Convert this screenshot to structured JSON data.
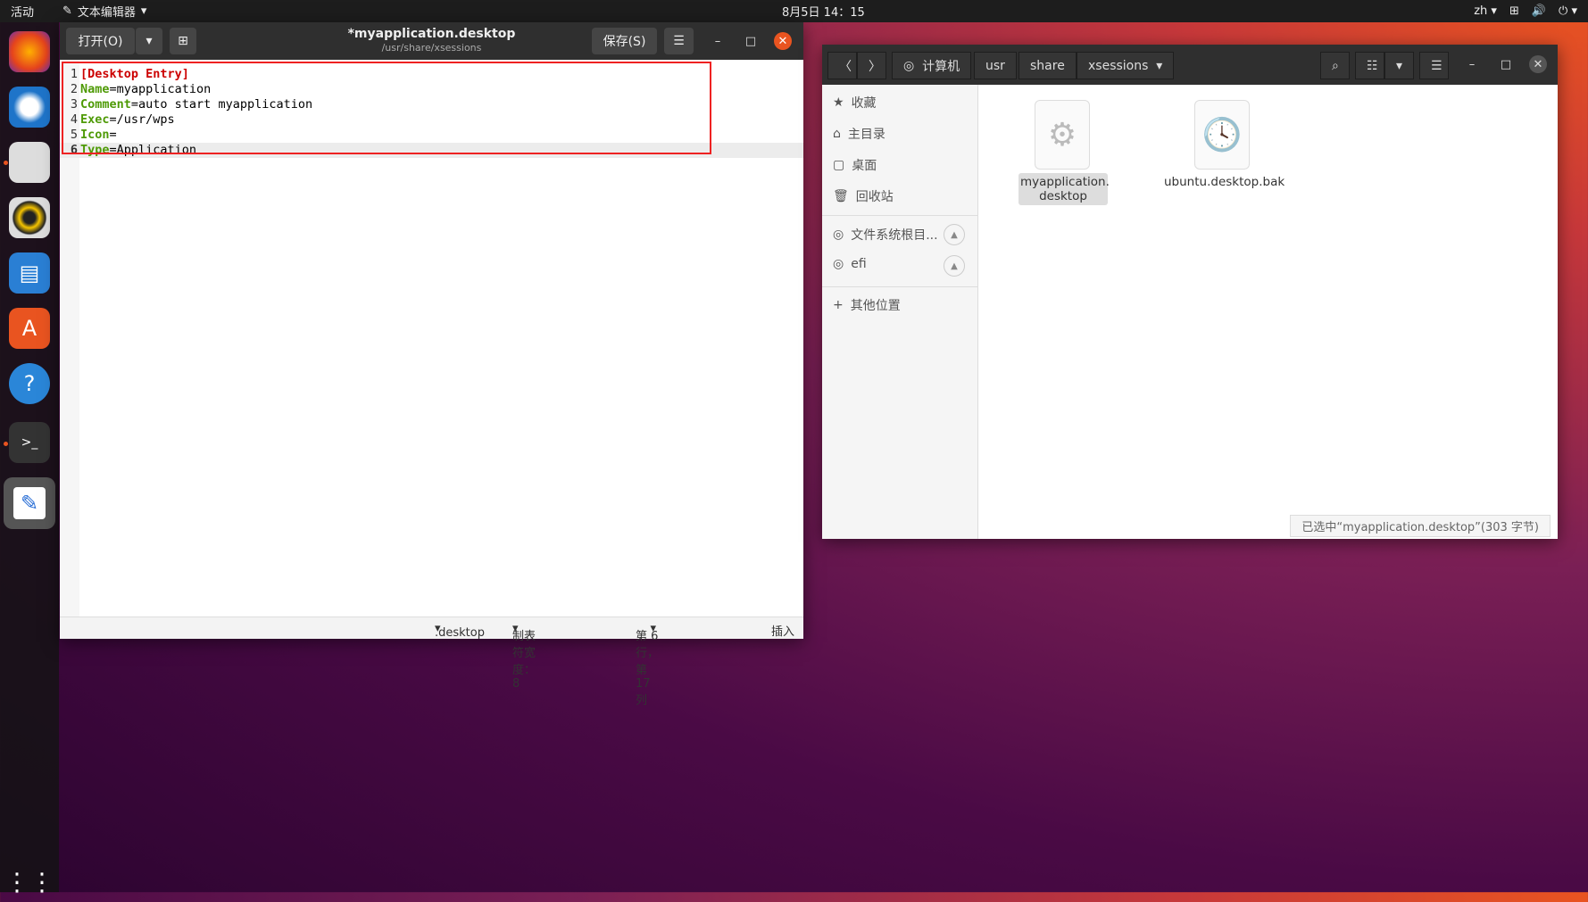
{
  "topbar": {
    "activities": "活动",
    "app_name": "文本编辑器",
    "clock": "8月5日 14：15",
    "lang": "zh"
  },
  "editor": {
    "open_label": "打开(O)",
    "save_label": "保存(S)",
    "title": "*myapplication.desktop",
    "path": "/usr/share/xsessions",
    "lines": [
      {
        "num": "1",
        "key": "",
        "rest": "[Desktop Entry]"
      },
      {
        "num": "2",
        "key": "Name",
        "rest": "=myapplication"
      },
      {
        "num": "3",
        "key": "Comment",
        "rest": "=auto start myapplication"
      },
      {
        "num": "4",
        "key": "Exec",
        "rest": "=/usr/wps"
      },
      {
        "num": "5",
        "key": "Icon",
        "rest": "="
      },
      {
        "num": "6",
        "key": "Type",
        "rest": "=Application"
      }
    ],
    "status": {
      "language": ".desktop",
      "tab_width": "制表符宽度：8",
      "position": "第 6 行，第 17 列",
      "mode": "插入"
    }
  },
  "files": {
    "breadcrumbs": [
      "计算机",
      "usr",
      "share",
      "xsessions"
    ],
    "sidebar": [
      "收藏",
      "主目录",
      "桌面",
      "回收站",
      "文件系统根目...",
      "efi",
      "其他位置"
    ],
    "items": [
      {
        "name1": "myapplication.",
        "name2": "desktop"
      },
      {
        "name1": "ubuntu.desktop.bak"
      }
    ],
    "status": "已选中“myapplication.desktop”(303 字节)"
  }
}
